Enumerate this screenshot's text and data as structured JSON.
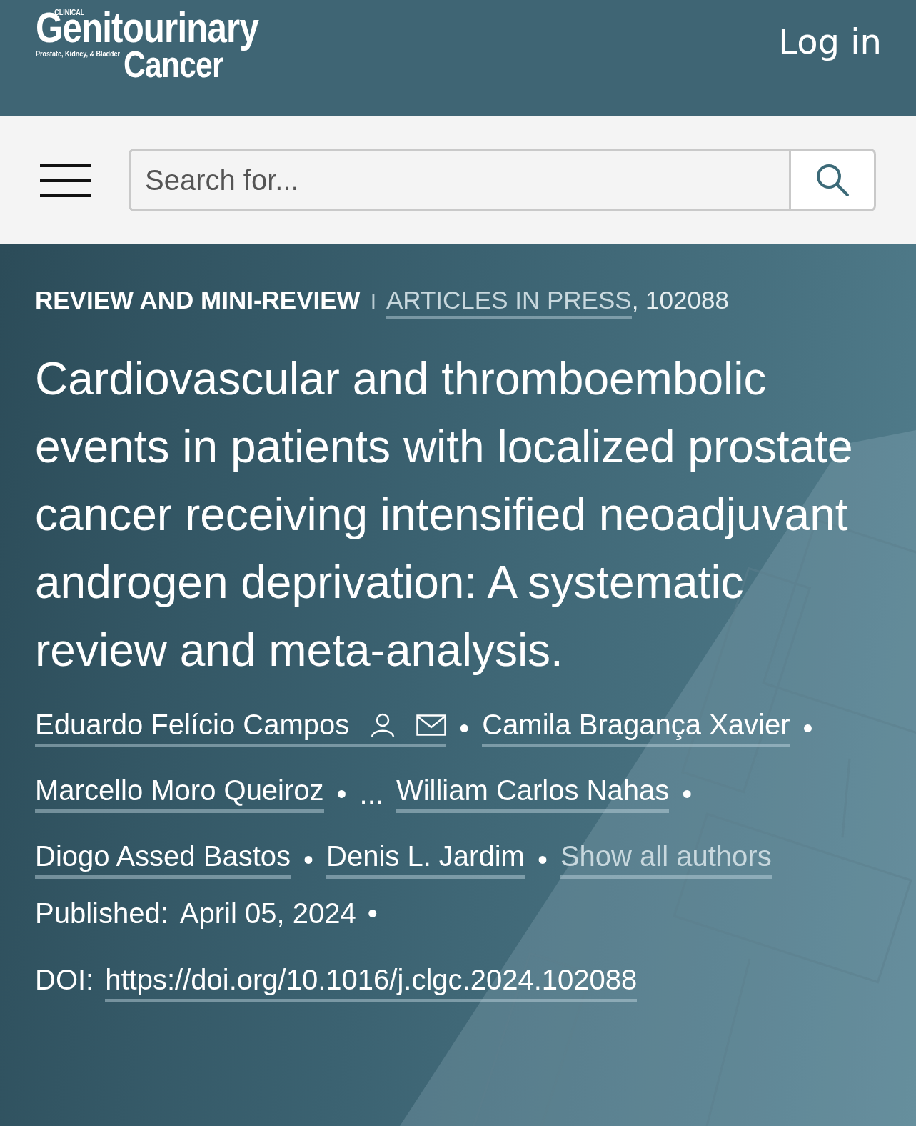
{
  "header": {
    "logo": {
      "top": "CLINICAL",
      "main": "Genitourinary",
      "tagline": "Prostate, Kidney, & Bladder",
      "bottom": "Cancer"
    },
    "login": "Log in"
  },
  "search": {
    "placeholder": "Search for..."
  },
  "article": {
    "section": "REVIEW AND MINI-REVIEW",
    "divider": "I",
    "issue_link": "ARTICLES IN PRESS",
    "article_number": ", 102088",
    "title": "Cardiovascular and thromboembolic events in patients with localized prostate cancer receiving intensified neoadjuvant androgen deprivation: A systematic review and meta-analysis.",
    "authors": [
      {
        "kind": "author",
        "name": "Eduardo Felício Campos",
        "contact_icons": true,
        "separator": "•"
      },
      {
        "kind": "author",
        "name": "Camila Bragança Xavier",
        "contact_icons": false,
        "separator": "•"
      },
      {
        "kind": "author",
        "name": "Marcello Moro Queiroz",
        "contact_icons": false,
        "separator": "•"
      },
      {
        "kind": "ellipsis",
        "name": "..."
      },
      {
        "kind": "author",
        "name": "William Carlos Nahas",
        "contact_icons": false,
        "separator": "•"
      },
      {
        "kind": "author",
        "name": "Diogo Assed Bastos",
        "contact_icons": false,
        "separator": "•"
      },
      {
        "kind": "author",
        "name": "Denis L. Jardim",
        "contact_icons": false,
        "separator": "•"
      },
      {
        "kind": "link",
        "name": "Show all authors"
      }
    ],
    "published_label": "Published:",
    "published_date": "April 05, 2024",
    "published_separator": "•",
    "doi_label": "DOI:",
    "doi": "https://doi.org/10.1016/j.clgc.2024.102088"
  }
}
